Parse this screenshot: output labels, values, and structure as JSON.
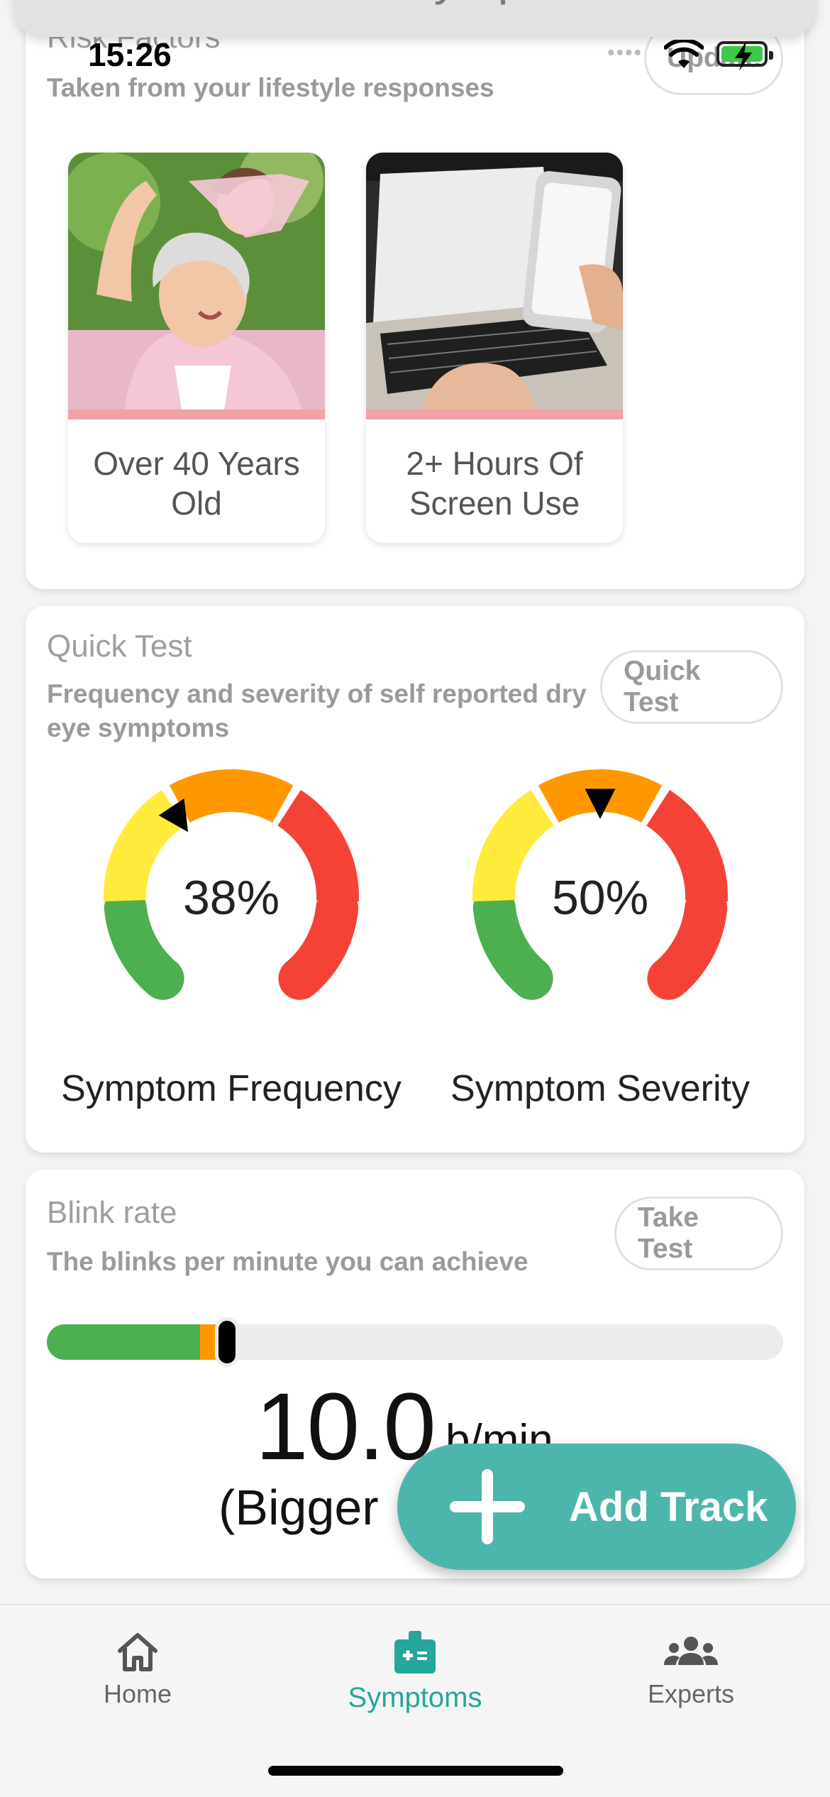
{
  "status_bar": {
    "time": "15:26"
  },
  "header": {
    "title": "Measure Symptoms"
  },
  "risk_factors": {
    "title": "Risk Factors",
    "subtitle": "Taken from your lifestyle responses",
    "update_label": "Update",
    "tiles": [
      {
        "label": "Over 40 Years Old",
        "image": "grandmother-with-child-photo"
      },
      {
        "label": "2+ Hours Of Screen Use",
        "image": "laptop-and-phone-photo"
      }
    ]
  },
  "quick_test": {
    "title": "Quick Test",
    "subtitle": "Frequency and severity of self reported dry eye symptoms",
    "button_label": "Quick Test",
    "gauges": [
      {
        "label": "Symptom Frequency",
        "value_text": "38%",
        "value": 38
      },
      {
        "label": "Symptom Severity",
        "value_text": "50%",
        "value": 50
      }
    ],
    "gauge_colors": {
      "green": "#4caf50",
      "yellow": "#ffeb3b",
      "orange": "#ff9800",
      "red": "#f44336"
    }
  },
  "blink_rate": {
    "title": "Blink rate",
    "subtitle": "The blinks per minute you can achieve",
    "button_label": "Take Test",
    "value": "10.0",
    "unit": "b/min",
    "note": "(Bigger",
    "progress_fraction": 0.245,
    "colors": {
      "green": "#4caf50",
      "orange": "#ff9800"
    }
  },
  "fab": {
    "label": "Add Track",
    "icon": "plus-icon"
  },
  "bottom_nav": {
    "items": [
      {
        "label": "Home",
        "icon": "home-icon",
        "active": false
      },
      {
        "label": "Symptoms",
        "icon": "medical-kit-icon",
        "active": true
      },
      {
        "label": "Experts",
        "icon": "group-icon",
        "active": false
      }
    ],
    "active_color": "#26a69a"
  }
}
